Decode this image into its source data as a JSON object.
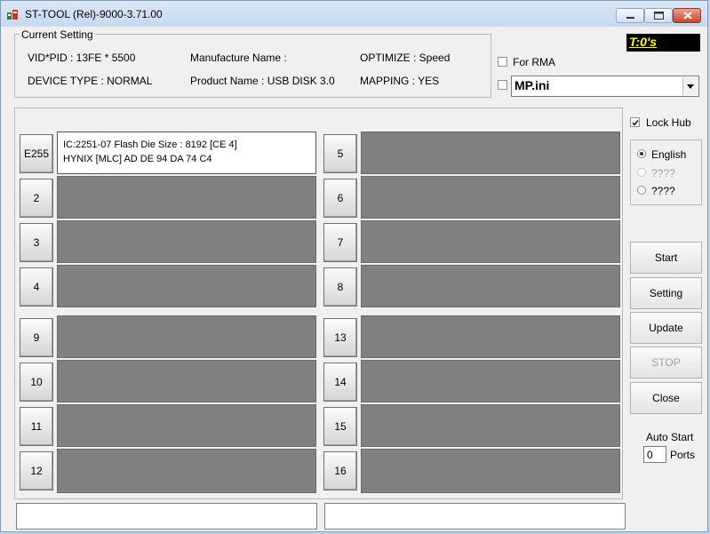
{
  "window": {
    "title": "ST-TOOL (Rel)-9000-3.71.00"
  },
  "current_setting": {
    "legend": "Current Setting",
    "vid_pid": "VID*PID : 13FE * 5500",
    "device_type": "DEVICE TYPE : NORMAL",
    "manufacture_name": "Manufacture Name :",
    "product_name": "Product Name : USB DISK 3.0",
    "optimize": "OPTIMIZE : Speed",
    "mapping": "MAPPING : YES"
  },
  "timer": {
    "text": "T:0's",
    "bg_color": "#000000",
    "text_color": "#ffff00"
  },
  "for_rma": {
    "label": "For RMA",
    "checked": false
  },
  "ini_select": {
    "value": "MP.ini",
    "checked": false
  },
  "lock_hub": {
    "label": "Lock Hub",
    "checked": true
  },
  "languages": [
    {
      "label": "English",
      "selected": true,
      "enabled": true
    },
    {
      "label": "????",
      "selected": false,
      "enabled": false
    },
    {
      "label": "????",
      "selected": false,
      "enabled": true
    }
  ],
  "ports_left": [
    {
      "label": "E255",
      "active": true,
      "info_line1": "IC:2251-07 Flash Die Size : 8192 [CE 4]",
      "info_line2": "HYNIX [MLC] AD DE 94 DA 74 C4"
    },
    {
      "label": "2",
      "active": false
    },
    {
      "label": "3",
      "active": false
    },
    {
      "label": "4",
      "active": false
    },
    {
      "label": "9",
      "active": false
    },
    {
      "label": "10",
      "active": false
    },
    {
      "label": "11",
      "active": false
    },
    {
      "label": "12",
      "active": false
    }
  ],
  "ports_right": [
    {
      "label": "5",
      "active": false
    },
    {
      "label": "6",
      "active": false
    },
    {
      "label": "7",
      "active": false
    },
    {
      "label": "8",
      "active": false
    },
    {
      "label": "13",
      "active": false
    },
    {
      "label": "14",
      "active": false
    },
    {
      "label": "15",
      "active": false
    },
    {
      "label": "16",
      "active": false
    }
  ],
  "actions": {
    "start": "Start",
    "setting": "Setting",
    "update": "Update",
    "stop": "STOP",
    "close": "Close"
  },
  "auto_start": {
    "label": "Auto Start",
    "value": "0",
    "unit": "Ports"
  },
  "icons": {
    "app": "app-icon",
    "minimize": "minimize-icon",
    "maximize": "maximize-icon",
    "close": "close-icon",
    "dropdown": "chevron-down-icon"
  }
}
